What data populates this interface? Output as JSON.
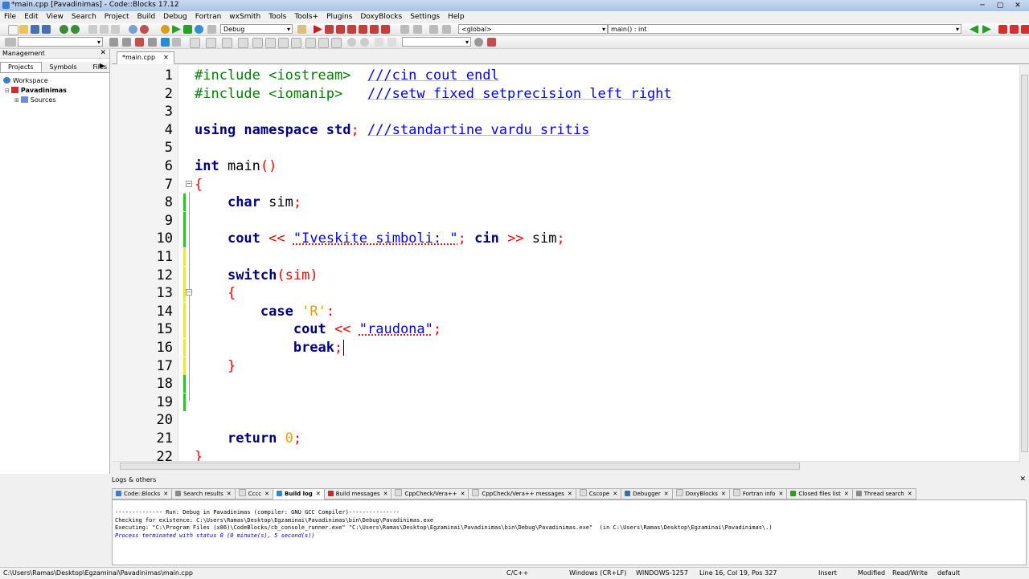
{
  "window": {
    "title": "*main.cpp [Pavadinimas] - Code::Blocks 17.12"
  },
  "menu": [
    "File",
    "Edit",
    "View",
    "Search",
    "Project",
    "Build",
    "Debug",
    "Fortran",
    "wxSmith",
    "Tools",
    "Tools+",
    "Plugins",
    "DoxyBlocks",
    "Settings",
    "Help"
  ],
  "toolbar": {
    "build_target": "Debug",
    "scope": "<global>",
    "function": "main() : int"
  },
  "management": {
    "title": "Management",
    "tabs": [
      "Projects",
      "Symbols",
      "Files"
    ],
    "tree": {
      "workspace": "Workspace",
      "project": "Pavadinimas",
      "folder": "Sources"
    }
  },
  "editor": {
    "tab": "*main.cpp",
    "line_numbers": [
      "1",
      "2",
      "3",
      "4",
      "5",
      "6",
      "7",
      "8",
      "9",
      "10",
      "11",
      "12",
      "13",
      "14",
      "15",
      "16",
      "17",
      "18",
      "19",
      "20",
      "21",
      "22"
    ]
  },
  "code": {
    "l1": {
      "pp": "#include <iostream>",
      "cm": "///cin cout endl"
    },
    "l2": {
      "pp": "#include <iomanip>",
      "cm": "///setw fixed setprecision left right"
    },
    "l4": {
      "kw1": "using namespace",
      "id": "std",
      "cm": "///standartine vardu sritis"
    },
    "l6": {
      "kw": "int",
      "id": "main",
      "par": "()"
    },
    "l7": {
      "brace": "{"
    },
    "l8": {
      "kw": "char",
      "id": "sim"
    },
    "l10": {
      "kw": "cout",
      "op1": "<<",
      "str": "\"Iveskite simboli: \"",
      "kw2": "cin",
      "op2": ">>",
      "id": "sim"
    },
    "l12": {
      "kw": "switch",
      "par": "(sim)"
    },
    "l13": {
      "brace": "{"
    },
    "l14": {
      "kw": "case",
      "ch": "'R'",
      "colon": ":"
    },
    "l15": {
      "kw": "cout",
      "op": "<<",
      "str": "\"raudona\""
    },
    "l16": {
      "kw": "break"
    },
    "l17": {
      "brace": "}"
    },
    "l21": {
      "kw": "return",
      "num": "0"
    },
    "l22": {
      "brace": "}"
    }
  },
  "logs": {
    "title": "Logs & others",
    "tabs": [
      "Code::Blocks",
      "Search results",
      "Cccc",
      "Build log",
      "Build messages",
      "CppCheck/Vera++",
      "CppCheck/Vera++ messages",
      "Cscope",
      "Debugger",
      "DoxyBlocks",
      "Fortran info",
      "Closed files list",
      "Thread search"
    ],
    "lines": [
      "-------------- Run: Debug in Pavadinimas (compiler: GNU GCC Compiler)---------------",
      "Checking for existence: C:\\Users\\Ramas\\Desktop\\Egzaminai\\Pavadinimas\\bin\\Debug\\Pavadinimas.exe",
      "Executing: \"C:\\Program Files (x86)\\CodeBlocks/cb_console_runner.exe\" \"C:\\Users\\Ramas\\Desktop\\Egzaminai\\Pavadinimas\\bin\\Debug\\Pavadinimas.exe\"  (in C:\\Users\\Ramas\\Desktop\\Egzaminai\\Pavadinimas\\.)",
      "Process terminated with status 0 (0 minute(s), 5 second(s))"
    ]
  },
  "status": {
    "path": "C:\\Users\\Ramas\\Desktop\\Egzaminai\\Pavadinimas\\main.cpp",
    "lang": "C/C++",
    "eol": "Windows (CR+LF)",
    "encoding": "WINDOWS-1257",
    "pos": "Line 16, Col 19, Pos 327",
    "mode": "Insert",
    "modified": "Modified",
    "rw": "Read/Write",
    "profile": "default"
  }
}
